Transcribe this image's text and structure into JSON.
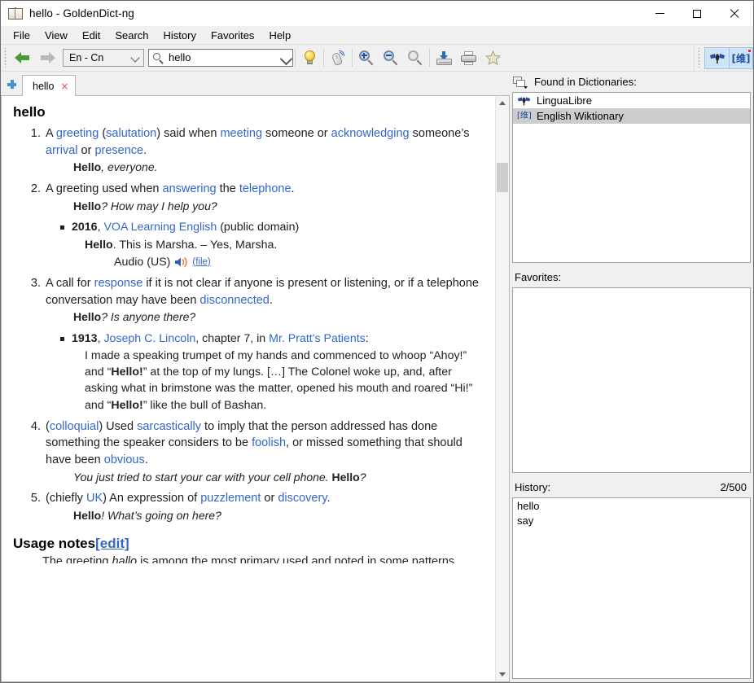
{
  "window": {
    "title": "hello - GoldenDict-ng",
    "icon": "book-icon",
    "controls": {
      "minimize": "minimize-icon",
      "maximize": "maximize-icon",
      "close": "close-icon"
    }
  },
  "menubar": {
    "items": [
      "File",
      "View",
      "Edit",
      "Search",
      "History",
      "Favorites",
      "Help"
    ]
  },
  "toolbar": {
    "back": "back-arrow-icon",
    "forward": "forward-arrow-icon",
    "language_pair": "En - Cn",
    "search": {
      "value": "hello",
      "icon": "search-icon",
      "dropdown": "chevron-down-icon"
    },
    "buttons": [
      {
        "name": "show-translation-bulb",
        "icon": "lightbulb-icon"
      },
      {
        "name": "scan-popup",
        "icon": "mouse-scan-icon"
      },
      {
        "name": "zoom-in",
        "icon": "zoom-in-icon"
      },
      {
        "name": "zoom-out",
        "icon": "zoom-out-icon"
      },
      {
        "name": "zoom-reset",
        "icon": "zoom-reset-icon"
      },
      {
        "name": "save-article",
        "icon": "save-icon"
      },
      {
        "name": "print",
        "icon": "printer-icon"
      },
      {
        "name": "add-favorite",
        "icon": "star-icon"
      }
    ],
    "dictionary_filters": [
      {
        "name": "lingualibre-filter",
        "icon": "lingualibre-icon",
        "active": true
      },
      {
        "name": "wiktionary-filter",
        "icon": "wiktionary-icon",
        "active": true
      }
    ]
  },
  "tabs": {
    "add_label": "+",
    "items": [
      {
        "label": "hello",
        "close": "×",
        "active": true
      }
    ],
    "arrange_icon": "arrange-panes-icon"
  },
  "article": {
    "headword": "hello",
    "senses": [
      {
        "parts": [
          {
            "t": "A "
          },
          {
            "t": "greeting",
            "link": true
          },
          {
            "t": " ("
          },
          {
            "t": "salutation",
            "link": true
          },
          {
            "t": ") said when "
          },
          {
            "t": "meeting",
            "link": true
          },
          {
            "t": " someone or "
          },
          {
            "t": "acknowledging",
            "link": true
          },
          {
            "t": " someone’s "
          },
          {
            "t": "arrival",
            "link": true
          },
          {
            "t": " or "
          },
          {
            "t": "presence",
            "link": true
          },
          {
            "t": "."
          }
        ],
        "example": {
          "bold": "Hello",
          "rest": ", everyone."
        }
      },
      {
        "parts": [
          {
            "t": "A greeting used when "
          },
          {
            "t": "answering",
            "link": true
          },
          {
            "t": " the "
          },
          {
            "t": "telephone",
            "link": true
          },
          {
            "t": "."
          }
        ],
        "example": {
          "bold": "Hello",
          "rest": "? How may I help you?"
        },
        "quote": {
          "year": "2016",
          "source": "VOA Learning English",
          "suffix": " (public domain)",
          "text_bold": "Hello",
          "text_rest": ". This is Marsha. – Yes, Marsha.",
          "audio_label": "Audio (US)",
          "audio_icon": "speaker-icon",
          "audio_file": "(file)"
        }
      },
      {
        "parts": [
          {
            "t": "A call for "
          },
          {
            "t": "response",
            "link": true
          },
          {
            "t": " if it is not clear if anyone is present or listening, or if a telephone conversation may have been "
          },
          {
            "t": "disconnected",
            "link": true
          },
          {
            "t": "."
          }
        ],
        "example": {
          "bold": "Hello",
          "rest": "? Is anyone there?"
        },
        "quote_book": {
          "year": "1913",
          "author": "Joseph C. Lincoln",
          "mid": ", chapter 7, in ",
          "work": "Mr. Pratt's Patients",
          "colon": ":",
          "text": "I made a speaking trumpet of my hands and commenced to whoop “Ahoy!” and “Hello!” at the top of my lungs. […] The Colonel woke up, and, after asking what in brimstone was the matter, opened his mouth and roared “Hi!” and “Hello!” like the bull of Bashan."
        }
      },
      {
        "parts": [
          {
            "t": "("
          },
          {
            "t": "colloquial",
            "link": true
          },
          {
            "t": ") Used "
          },
          {
            "t": "sarcastically",
            "link": true
          },
          {
            "t": " to imply that the person addressed has done something the speaker considers to be "
          },
          {
            "t": "foolish",
            "link": true
          },
          {
            "t": ", or missed something that should have been "
          },
          {
            "t": "obvious",
            "link": true
          },
          {
            "t": "."
          }
        ],
        "example": {
          "pre": "You just tried to start your car with your cell phone. ",
          "bold": "Hello",
          "rest": "?"
        }
      },
      {
        "parts": [
          {
            "t": "(chiefly "
          },
          {
            "t": "UK",
            "link": true
          },
          {
            "t": ") An expression of "
          },
          {
            "t": "puzzlement",
            "link": true
          },
          {
            "t": " or "
          },
          {
            "t": "discovery",
            "link": true
          },
          {
            "t": "."
          }
        ],
        "example": {
          "bold": "Hello",
          "rest": "! What’s going on here?"
        }
      }
    ],
    "section": {
      "title": "Usage notes",
      "edit": "[edit]"
    }
  },
  "rightpane": {
    "found_label": "Found in Dictionaries:",
    "dictionaries": [
      {
        "label": "LinguaLibre",
        "icon": "lingualibre-icon",
        "selected": false
      },
      {
        "label": "English Wiktionary",
        "icon": "wiktionary-icon",
        "selected": true
      }
    ],
    "favorites_label": "Favorites:",
    "favorites": [],
    "history_label": "History:",
    "history_count": "2/500",
    "history": [
      "hello",
      "say"
    ]
  },
  "colors": {
    "link": "#3366cc",
    "selection": "#cdcdcd",
    "accent": "#4a90d9",
    "chrome": "#f0f0f0"
  }
}
